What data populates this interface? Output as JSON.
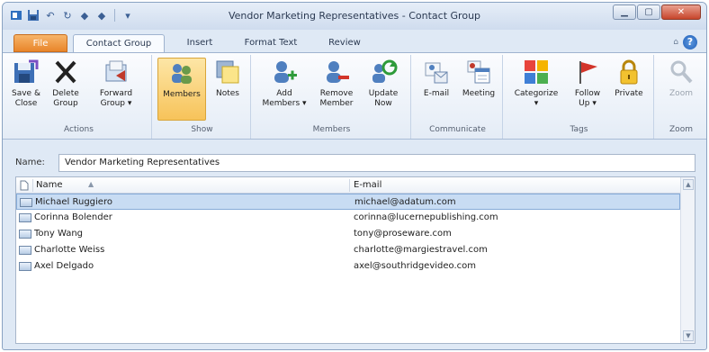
{
  "window": {
    "title": "Vendor Marketing Representatives - Contact Group"
  },
  "tabs": [
    {
      "label": "File"
    },
    {
      "label": "Contact Group"
    },
    {
      "label": "Insert"
    },
    {
      "label": "Format Text"
    },
    {
      "label": "Review"
    }
  ],
  "ribbon": {
    "actions": {
      "label": "Actions",
      "save_close": [
        "Save &",
        "Close"
      ],
      "delete_group": [
        "Delete",
        "Group"
      ],
      "forward_group": [
        "Forward",
        "Group ▾"
      ]
    },
    "show": {
      "label": "Show",
      "members": "Members",
      "notes": "Notes"
    },
    "members": {
      "label": "Members",
      "add_members": [
        "Add",
        "Members ▾"
      ],
      "remove_member": [
        "Remove",
        "Member"
      ],
      "update_now": [
        "Update",
        "Now"
      ]
    },
    "communicate": {
      "label": "Communicate",
      "email": "E-mail",
      "meeting": "Meeting"
    },
    "tags": {
      "label": "Tags",
      "categorize": [
        "Categorize",
        "▾"
      ],
      "follow_up": [
        "Follow",
        "Up ▾"
      ],
      "private": "Private"
    },
    "zoom": {
      "label": "Zoom",
      "zoom": "Zoom"
    }
  },
  "name_field": {
    "label": "Name:",
    "value": "Vendor Marketing Representatives"
  },
  "list": {
    "headers": {
      "name": "Name",
      "email": "E-mail"
    },
    "rows": [
      {
        "name": "Michael Ruggiero",
        "email": "michael@adatum.com"
      },
      {
        "name": "Corinna Bolender",
        "email": "corinna@lucernepublishing.com"
      },
      {
        "name": "Tony Wang",
        "email": "tony@proseware.com"
      },
      {
        "name": "Charlotte Weiss",
        "email": "charlotte@margiestravel.com"
      },
      {
        "name": "Axel Delgado",
        "email": "axel@southridgevideo.com"
      }
    ]
  },
  "colors": {
    "file_tab": "#e8852a",
    "selection": "#c8dcf3",
    "members_active": "#f7c35a"
  }
}
